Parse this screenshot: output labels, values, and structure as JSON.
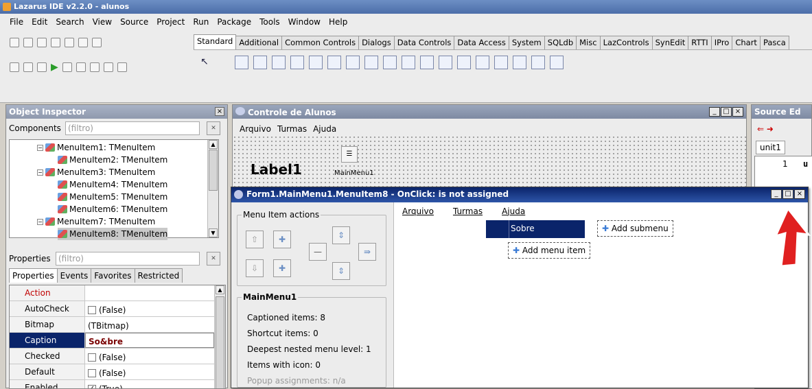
{
  "ide": {
    "title": "Lazarus IDE v2.2.0 - alunos",
    "menu": [
      "File",
      "Edit",
      "Search",
      "View",
      "Source",
      "Project",
      "Run",
      "Package",
      "Tools",
      "Window",
      "Help"
    ]
  },
  "palette": {
    "tabs": [
      "Standard",
      "Additional",
      "Common Controls",
      "Dialogs",
      "Data Controls",
      "Data Access",
      "System",
      "SQLdb",
      "Misc",
      "LazControls",
      "SynEdit",
      "RTTI",
      "IPro",
      "Chart",
      "Pasca"
    ]
  },
  "inspector": {
    "title": "Object Inspector",
    "components_label": "Components",
    "filter": "(filtro)",
    "tree": [
      {
        "label": "MenuItem1: TMenuItem",
        "indent": 1,
        "expander": "−"
      },
      {
        "label": "MenuItem2: TMenuItem",
        "indent": 2
      },
      {
        "label": "MenuItem3: TMenuItem",
        "indent": 1,
        "expander": "−"
      },
      {
        "label": "MenuItem4: TMenuItem",
        "indent": 2
      },
      {
        "label": "MenuItem5: TMenuItem",
        "indent": 2
      },
      {
        "label": "MenuItem6: TMenuItem",
        "indent": 2
      },
      {
        "label": "MenuItem7: TMenuItem",
        "indent": 1,
        "expander": "−"
      },
      {
        "label": "MenuItem8: TMenuItem",
        "indent": 2,
        "selected": true
      }
    ],
    "properties_label": "Properties",
    "prop_filter": "(filtro)",
    "tabs": [
      "Properties",
      "Events",
      "Favorites",
      "Restricted"
    ],
    "props": [
      {
        "name": "Action",
        "value": ""
      },
      {
        "name": "AutoCheck",
        "value": "(False)",
        "check": ""
      },
      {
        "name": "Bitmap",
        "value": "(TBitmap)"
      },
      {
        "name": "Caption",
        "value": "So&bre",
        "current": true
      },
      {
        "name": "Checked",
        "value": "(False)",
        "check": ""
      },
      {
        "name": "Default",
        "value": "(False)",
        "check": ""
      },
      {
        "name": "Enabled",
        "value": "(True)",
        "check": "✓"
      }
    ]
  },
  "form": {
    "title": "Controle de Alunos",
    "menu": [
      "Arquivo",
      "Turmas",
      "Ajuda"
    ],
    "label1": "Label1",
    "mainmenu_caption": "MainMenu1"
  },
  "source": {
    "title": "Source Ed",
    "tab": "unit1",
    "line_no": "1",
    "line_text": "u"
  },
  "menu_editor": {
    "title": "Form1.MainMenu1.MenuItem8 - OnClick: is not assigned",
    "actions_label": "Menu Item actions",
    "info_label": "MainMenu1",
    "info": [
      "Captioned items: 8",
      "Shortcut items: 0",
      "Deepest nested menu level: 1",
      "Items with icon: 0",
      "Popup assignments: n/a"
    ],
    "bar": [
      "Arquivo",
      "Turmas",
      "Ajuda"
    ],
    "selected_item": "Sobre",
    "add_submenu": "Add submenu",
    "add_menu_item": "Add menu item"
  },
  "colors": {
    "selection": "#0a246a",
    "arrow": "#e02020"
  }
}
